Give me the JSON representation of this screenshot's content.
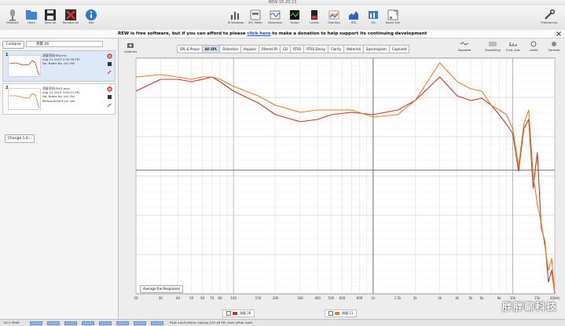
{
  "window": {
    "title": "REW V5.20.13"
  },
  "toolbar": {
    "left": [
      {
        "label": "Measure",
        "icon": "measure-icon"
      },
      {
        "label": "Open",
        "icon": "open-icon"
      },
      {
        "label": "Save All",
        "icon": "save-all-icon"
      },
      {
        "label": "Remove All",
        "icon": "remove-all-icon"
      },
      {
        "label": "Info",
        "icon": "info-icon"
      }
    ],
    "center": [
      {
        "label": "SI Windows",
        "icon": "windows-icon"
      },
      {
        "label": "SPL Meter",
        "icon": "spl-meter-icon"
      },
      {
        "label": "Generator",
        "icon": "generator-icon"
      },
      {
        "label": "Scope",
        "icon": "scope-icon"
      },
      {
        "label": "Levels",
        "icon": "levels-icon"
      },
      {
        "label": "Overlays",
        "icon": "overlays-icon"
      },
      {
        "label": "RTA",
        "icon": "rta-icon"
      },
      {
        "label": "EQ",
        "icon": "eq-icon"
      },
      {
        "label": "Room Sim",
        "icon": "room-sim-icon"
      }
    ],
    "right": {
      "label": "Preferences",
      "icon": "preferences-icon"
    }
  },
  "banner": {
    "text_before": "REW is free software, but if you can afford to please",
    "link": "click here",
    "text_after": "to make a donation to help support its continuing development"
  },
  "left_panel": {
    "collapse_label": "Collapse",
    "name_field_value": "测量 26",
    "measurements": [
      {
        "num": "1",
        "name": "测量耳机HSK-mic",
        "date": "Aug 21 2023 2:55:39 PM",
        "note": "No. Notes  No. cal. file",
        "extra": ""
      },
      {
        "num": "2",
        "name": "测量耳机HSK5.mav",
        "date": "Aug 21 2023 3:04:12 PM",
        "note": "No. Notes  No. cal. file",
        "extra": "Measurement cal. sat"
      }
    ],
    "change_label": "Change 1.0..."
  },
  "graph": {
    "captures_label": "Captures",
    "tabs": [
      "SPL & Phase",
      "All SPL",
      "Distortion",
      "Impulse",
      "Filtered IR",
      "GD",
      "RT60",
      "RT60 Decay",
      "Clarity",
      "Waterfall",
      "Spectrogram",
      "Captured"
    ],
    "active_tab": "All SPL",
    "right_buttons": [
      {
        "label": "Separate",
        "icon": "separate-icon"
      },
      {
        "label": "Smoothing",
        "icon": "smoothing-icon"
      },
      {
        "label": "Freq. Axis",
        "icon": "freq-axis-icon"
      },
      {
        "label": "Limits",
        "icon": "limits-icon"
      },
      {
        "label": "Controls",
        "icon": "controls-icon"
      }
    ],
    "average_label": "Average the Responses",
    "legend": [
      {
        "label": "测量 26",
        "color": "#c0392b"
      },
      {
        "label": "测量 21",
        "color": "#e67e22"
      }
    ]
  },
  "chart_data": {
    "type": "line",
    "x_scale": "log",
    "xlim": [
      20,
      20000
    ],
    "x_ticks": [
      "20",
      "30",
      "40",
      "50",
      "60",
      "70",
      "80",
      "100",
      "150",
      "200",
      "300",
      "400",
      "500",
      "600",
      "800",
      "1k",
      "1.5k",
      "2k",
      "3k",
      "4k",
      "5k",
      "6k",
      "8k",
      "10k",
      "15k",
      "20kHz"
    ],
    "grid": true,
    "series": [
      {
        "color": "#c0392b",
        "x": [
          20,
          30,
          40,
          50,
          60,
          70,
          80,
          100,
          150,
          200,
          300,
          400,
          500,
          700,
          1000,
          1500,
          2000,
          3000,
          4000,
          5000,
          6000,
          7000,
          8000,
          9000,
          10000,
          11000,
          12000,
          13000,
          14000,
          15000,
          16000,
          17000,
          18000,
          19000,
          20000
        ],
        "y": [
          0.14,
          0.09,
          0.09,
          0.1,
          0.09,
          0.08,
          0.1,
          0.14,
          0.19,
          0.24,
          0.27,
          0.26,
          0.24,
          0.23,
          0.24,
          0.22,
          0.18,
          0.08,
          0.16,
          0.18,
          0.17,
          0.2,
          0.24,
          0.28,
          0.32,
          0.48,
          0.3,
          0.26,
          0.55,
          0.4,
          0.72,
          0.78,
          0.95,
          0.9,
          1.0
        ]
      },
      {
        "color": "#e67e22",
        "x": [
          20,
          30,
          40,
          50,
          60,
          70,
          80,
          100,
          150,
          200,
          300,
          400,
          500,
          700,
          1000,
          1500,
          2000,
          3000,
          4000,
          5000,
          6000,
          7000,
          8000,
          9000,
          10000,
          11000,
          12000,
          13000,
          14000,
          15000,
          16000,
          17000,
          18000,
          19000,
          20000
        ],
        "y": [
          0.08,
          0.07,
          0.08,
          0.09,
          0.08,
          0.08,
          0.09,
          0.12,
          0.16,
          0.2,
          0.23,
          0.22,
          0.22,
          0.22,
          0.25,
          0.24,
          0.18,
          0.02,
          0.1,
          0.13,
          0.14,
          0.2,
          0.22,
          0.24,
          0.3,
          0.46,
          0.28,
          0.22,
          0.5,
          0.62,
          0.7,
          0.8,
          0.9,
          0.85,
          1.0
        ]
      }
    ]
  },
  "status": {
    "left": "1% 0 96dB",
    "segments": [
      "-1  0  -6  -10  ...",
      "Peak input before clipping 120 dB SPL  Auto-offset used"
    ]
  },
  "watermark": "胖胖聊科技"
}
